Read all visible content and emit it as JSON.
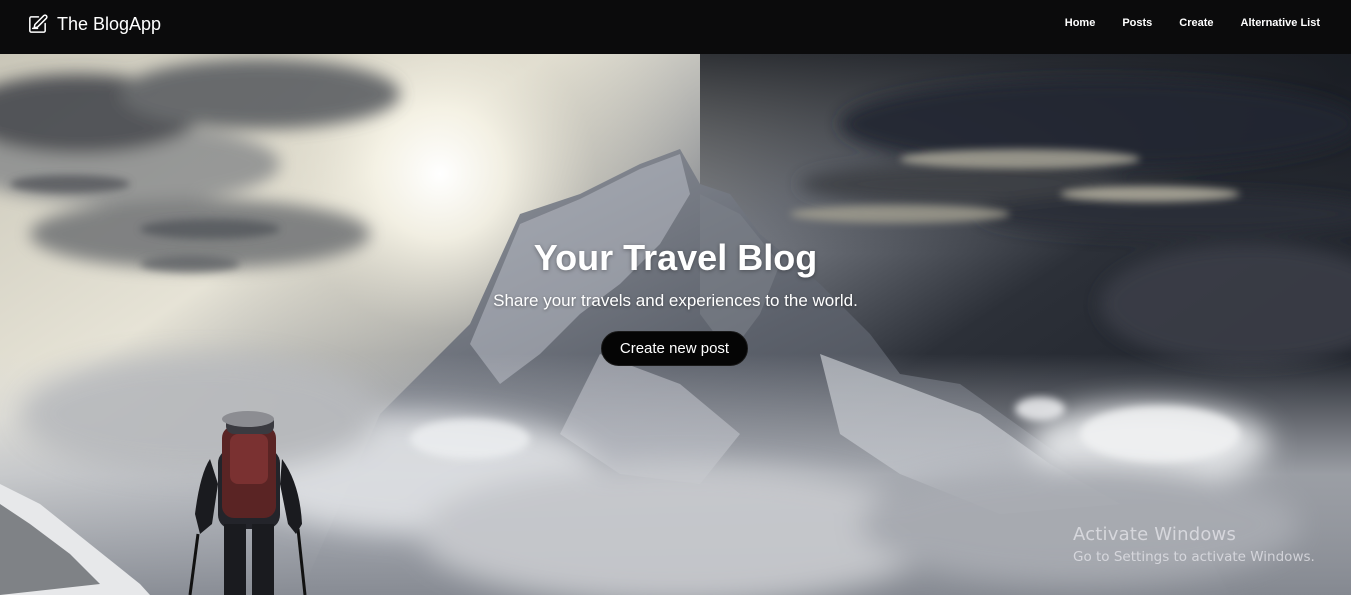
{
  "navbar": {
    "brand_icon": "edit-icon",
    "brand": "The BlogApp",
    "links": [
      "Home",
      "Posts",
      "Create",
      "Alternative List"
    ]
  },
  "hero": {
    "title": "Your Travel Blog",
    "subtitle": "Share your travels and experiences to the world.",
    "cta_label": "Create new post",
    "background": "mountain-hiker-photo"
  },
  "watermark": {
    "title": "Activate Windows",
    "subtitle": "Go to Settings to activate Windows."
  }
}
